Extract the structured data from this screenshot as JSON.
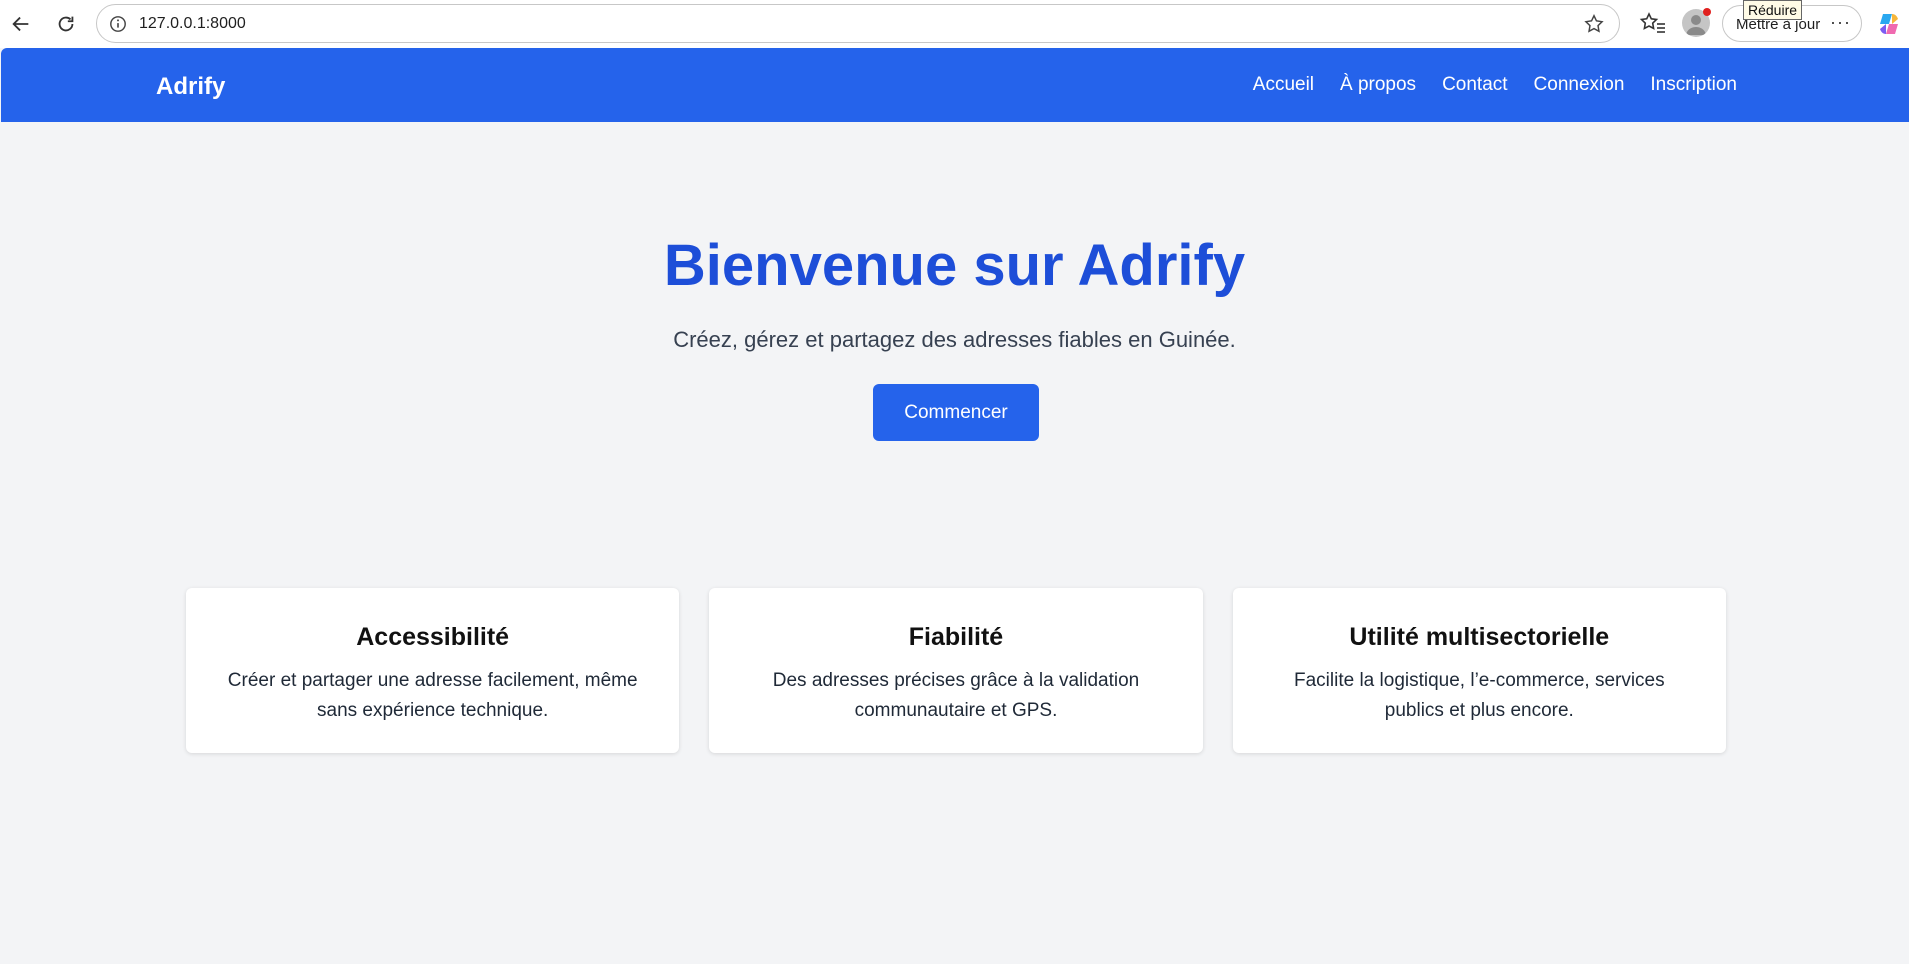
{
  "browser": {
    "url": "127.0.0.1:8000",
    "update_label": "Mettre à jour",
    "tooltip": "Réduire",
    "more": "···"
  },
  "site": {
    "brand": "Adrify",
    "nav": [
      "Accueil",
      "À propos",
      "Contact",
      "Connexion",
      "Inscription"
    ]
  },
  "hero": {
    "title": "Bienvenue sur Adrify",
    "subtitle": "Créez, gérez et partagez des adresses fiables en Guinée.",
    "cta": "Commencer"
  },
  "features": [
    {
      "title": "Accessibilité",
      "text": "Créer et partager une adresse facilement, même sans expérience technique."
    },
    {
      "title": "Fiabilité",
      "text": "Des adresses précises grâce à la validation communautaire et GPS."
    },
    {
      "title": "Utilité multisectorielle",
      "text": "Facilite la logistique, l’e-commerce, services publics et plus encore."
    }
  ],
  "colors": {
    "primary": "#2563eb",
    "title": "#1d4ed8",
    "background": "#f3f4f6"
  }
}
